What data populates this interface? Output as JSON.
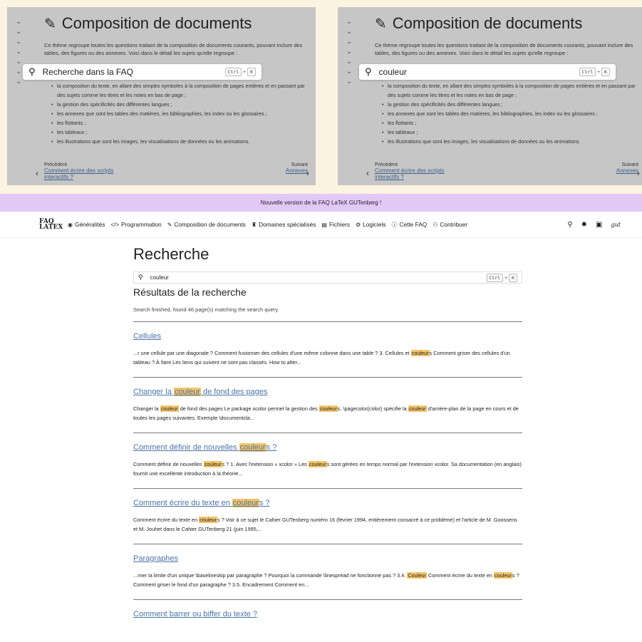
{
  "panels": [
    {
      "title": "Composition de documents",
      "intro": "Ce thème regroupe toutes les questions traitant de la composition de documents courants, pouvant inclure des tables, des figures ou des annexes. Voici dans le détail les sujets qu'elle regroupe :",
      "search_text": "Recherche dans la FAQ",
      "prev_label": "Précédent",
      "prev_link": "Comment écrire des scripts interactifs ?",
      "next_label": "Suivant",
      "next_link": "Annexes"
    },
    {
      "title": "Composition de documents",
      "intro": "Ce thème regroupe toutes les questions traitant de la composition de documents courants, pouvant inclure des tables, des figures ou des annexes. Voici dans le détail les sujets qu'elle regroupe :",
      "search_text": "couleur",
      "prev_label": "Précédent",
      "prev_link": "Comment écrire des scripts interactifs ?",
      "next_label": "Suivant",
      "next_link": "Annexes"
    }
  ],
  "panel_list": [
    "la composition du texte, en allant des simples symboles à la composition de pages entières et en passant par des sujets comme les titres et les notes en bas de page ;",
    "la gestion des spécificités des différentes langues ;",
    "les annexes que sont les tables des matières, les bibliographies, les index ou les glossaires ;",
    "les flottants ;",
    "les tableaux ;",
    "les illustrations que sont les images, les visualisations de données ou les animations."
  ],
  "kbd": {
    "ctrl": "Ctrl",
    "plus": "+",
    "k": "K"
  },
  "banner": "Nouvelle version de la FAQ LaTeX GUTenberg !",
  "logo": {
    "line1": "FAQ",
    "line2": "LATEX"
  },
  "nav": [
    {
      "icon": "◉",
      "label": "Généralités"
    },
    {
      "icon": "</>",
      "label": "Programmation"
    },
    {
      "icon": "✎",
      "label": "Composition de documents"
    },
    {
      "icon": "♜",
      "label": "Domaines spécialisés"
    },
    {
      "icon": "▤",
      "label": "Fichiers"
    },
    {
      "icon": "⚙",
      "label": "Logiciels"
    },
    {
      "icon": "ⓘ",
      "label": "Cette FAQ"
    },
    {
      "icon": "⚇",
      "label": "Contribuer"
    }
  ],
  "nav_right": {
    "search": "🔍",
    "theme": "✹",
    "book": "▣",
    "gut": "gut"
  },
  "page": {
    "title": "Recherche",
    "search_value": "couleur",
    "results_heading": "Résultats de la recherche",
    "status": "Search finished, found 46 page(s) matching the search query."
  },
  "results": [
    {
      "title": "Cellules",
      "snippet": "...r une cellule par une diagonale ? Comment fusionner des cellules d'une même colonne dans une table ? 3. Cellules et couleurs Comment griser des cellules d'un tableau ? À faire Les liens qui suivent ne sont pas classés. How to alter..."
    },
    {
      "title": "Changer la couleur de fond des pages",
      "snippet": "Changer la couleur de fond des pages Le package xcolor permet la gestion des couleurs. \\pagecolor{color} spécifie la couleur d'arrière-plan de la page en cours et de toutes les pages suivantes. Exemple \\documentcla..."
    },
    {
      "title": "Comment définir de nouvelles couleurs ?",
      "snippet": "Comment définir de nouvelles couleurs ? 1.  Avec l'extension « xcolor » Les couleurs sont gérées en temps normal par l'extension xcolor. Sa documentation (en anglais) fournit une excellente introduction à la théorie..."
    },
    {
      "title": "Comment écrire du texte en couleurs ?",
      "snippet": "Comment écrire du texte en couleurs ? Voir à ce sujet le Cahier GUTenberg numéro 16 (février 1994, entièrement consacré à ce problème) et l'article de M. Goossens et M. Jouhet dans le Cahier GUTenberg 21 (juin 1995,..."
    },
    {
      "title": "Paragraphes",
      "snippet": "...rner la limite d'un unique \\baselineskip par paragraphe ? Pourquoi la commande \\linespread ne fonctionne pas ? 3.4.  Couleur Comment écrire du texte en couleurs ? Comment griser le fond d'un paragraphe ? 3.5.  Encadrement Comment en..."
    },
    {
      "title": "Comment barrer ou biffer du texte ?",
      "snippet": ""
    }
  ],
  "highlight_term": "couleur"
}
